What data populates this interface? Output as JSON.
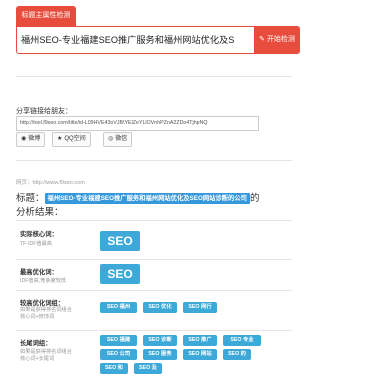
{
  "tab": {
    "label": "标题主属性检测"
  },
  "search": {
    "value": "福州SEO-专业福建SEO推广服务和福州网站优化及S",
    "button_label": "开始检测",
    "button_icon": "pencil-square-icon"
  },
  "share": {
    "label": "分享链接给朋友：",
    "url": "http://tool.f9seo.com/title/id-L09HVE43oVJB\\YElZeYLlOVnhPZnA2ZDo4TjhpNQ",
    "buttons": [
      {
        "label": "微博",
        "icon": "weibo-icon"
      },
      {
        "label": "QQ空间",
        "icon": "star-icon"
      },
      {
        "label": "微信",
        "icon": "wechat-icon"
      }
    ]
  },
  "result": {
    "site": "网页：http://www.f9seo.com",
    "title_prefix": "标题：",
    "title_text": "福州SEO-专业福建SEO推广服务和福州网站优化及SEO网站诊断的公司",
    "title_suffix": "的",
    "subtitle": "分析结果：",
    "rows": [
      {
        "label": "实际核心词：",
        "hint": [
          "TF-IDF值最高"
        ],
        "tags": [
          "SEO"
        ]
      },
      {
        "label": "最高优化词：",
        "hint": [
          "IDF值高,竞争度较低"
        ],
        "tags": [
          "SEO"
        ]
      },
      {
        "label": "较高优化词组：",
        "hint": [
          "如果是获得排名词组合",
          "核心词+修饰词"
        ],
        "tags": [
          "SEO 福州",
          "SEO 优化",
          "SEO 网行"
        ]
      },
      {
        "label": "长尾词组：",
        "hint": [
          "如果是获得排名词组合",
          "核心词+长尾词"
        ],
        "tags": [
          "SEO 福建",
          "SEO 诊断",
          "SEO 推广",
          "SEO 专业",
          "SEO 公司",
          "SEO 服务",
          "SEO 网站",
          "SEO 的",
          "SEO 和",
          "SEO 及"
        ]
      }
    ]
  },
  "colors": {
    "accent": "#e74c3c",
    "tag": "#3da9d8",
    "title_highlight": "#3498db"
  }
}
